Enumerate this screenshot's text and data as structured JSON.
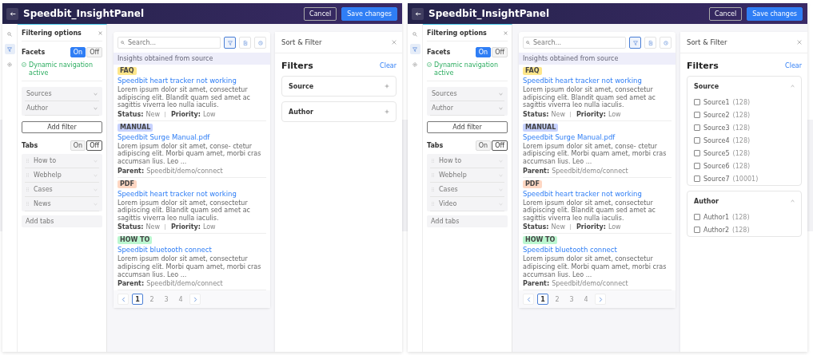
{
  "windows": [
    {
      "title": "Speedbit_InsightPanel",
      "buttons": [
        "Cancel",
        "Save changes"
      ],
      "rail": [
        {
          "kind": "search",
          "selected": false
        },
        {
          "kind": "filter",
          "selected": true
        },
        {
          "kind": "settings",
          "selected": false
        }
      ],
      "options": {
        "title": "Filtering options",
        "facets_label": "Facets",
        "facets_toggle": [
          {
            "label": "On",
            "selected": true
          },
          {
            "label": "Off",
            "selected": false
          }
        ],
        "status": "Dynamic navigation active",
        "facets": [
          "Sources",
          "Author"
        ],
        "add_button": "Add filter",
        "tabs_label": "Tabs",
        "tabs_toggle": [
          {
            "label": "On",
            "selected": false
          },
          {
            "label": "Off",
            "selected": true
          }
        ],
        "tabs": [
          "How to",
          "Webhelp",
          "Cases",
          "News"
        ],
        "add_tabs": {
          "placeholder": "Add tabs"
        }
      },
      "results": {
        "search": {
          "placeholder": "Search..."
        },
        "tools": [
          {
            "kind": "filter",
            "selected": true
          },
          {
            "kind": "doc",
            "selected": false
          },
          {
            "kind": "clock",
            "selected": false
          }
        ],
        "info": "Insights obtained from source",
        "items": [
          {
            "tag": "FAQ",
            "color": "#fde68a",
            "title": "Speedbit heart tracker not working",
            "snippet": "Lorem ipsum dolor sit amet, consectetur adipiscing elit. Blandit quam sed amet ac sagittis viverra leo nulla iaculis.",
            "meta": [
              {
                "label": "Status:",
                "value": "New"
              },
              {
                "label": "Priority:",
                "value": "Low"
              }
            ]
          },
          {
            "tag": "MANUAL",
            "color": "#c7d2fe",
            "title": "Speedbit Surge Manual.pdf",
            "snippet": "Lorem ipsum dolor sit amet, conse- ctetur adipiscing elit. Morbi quam amet, morbi cras accumsan lius. Leo ...",
            "meta": [
              {
                "label": "Parent:",
                "value": "Speedbit/demo/connect"
              }
            ]
          },
          {
            "tag": "PDF",
            "color": "#fed7c3",
            "title": "Speedbit heart tracker not working",
            "snippet": "Lorem ipsum dolor sit amet, consectetur adipiscing elit. Blandit quam sed amet ac sagittis viverra leo nulla iaculis.",
            "meta": [
              {
                "label": "Status:",
                "value": "New"
              },
              {
                "label": "Priority:",
                "value": "Low"
              }
            ]
          },
          {
            "tag": "HOW TO",
            "color": "#bbf7d0",
            "title": "Speedbit bluetooth connect",
            "snippet": "Lorem ipsum dolor sit amet, consectetur adipiscing elit. Morbi quam amet, morbi cras accumsan lius. Leo ...",
            "meta": [
              {
                "label": "Parent:",
                "value": "Speedbit/demo/connect"
              }
            ]
          }
        ],
        "pages": [
          {
            "label": "1",
            "selected": true
          },
          {
            "label": "2",
            "selected": false
          },
          {
            "label": "3",
            "selected": false
          },
          {
            "label": "4",
            "selected": false
          }
        ]
      },
      "sort": {
        "title": "Sort & Filter",
        "heading": "Filters",
        "clear": "Clear",
        "sections": [
          {
            "name": "Source",
            "expanded": false
          },
          {
            "name": "Author",
            "expanded": false
          }
        ]
      }
    },
    {
      "title": "Speedbit_InsightPanel",
      "buttons": [
        "Cancel",
        "Save changes"
      ],
      "rail": [
        {
          "kind": "search",
          "selected": false
        },
        {
          "kind": "filter",
          "selected": true
        },
        {
          "kind": "settings",
          "selected": false
        }
      ],
      "options": {
        "title": "Filtering options",
        "facets_label": "Facets",
        "facets_toggle": [
          {
            "label": "On",
            "selected": true
          },
          {
            "label": "Off",
            "selected": false
          }
        ],
        "status": "Dynamic navigation active",
        "facets": [
          "Sources",
          "Author"
        ],
        "add_button": "Add filter",
        "tabs_label": "Tabs",
        "tabs_toggle": [
          {
            "label": "On",
            "selected": false
          },
          {
            "label": "Off",
            "selected": true
          }
        ],
        "tabs": [
          "How to",
          "Webhelp",
          "Cases",
          "Video"
        ],
        "add_tabs": {
          "placeholder": "Add tabs"
        }
      },
      "results": {
        "search": {
          "placeholder": "Search..."
        },
        "tools": [
          {
            "kind": "filter",
            "selected": true
          },
          {
            "kind": "doc",
            "selected": false
          },
          {
            "kind": "clock",
            "selected": false
          }
        ],
        "info": "Insights obtained from source",
        "items": [
          {
            "tag": "FAQ",
            "color": "#fde68a",
            "title": "Speedbit heart tracker not working",
            "snippet": "Lorem ipsum dolor sit amet, consectetur adipiscing elit. Blandit quam sed amet ac sagittis viverra leo nulla iaculis.",
            "meta": [
              {
                "label": "Status:",
                "value": "New"
              },
              {
                "label": "Priority:",
                "value": "Low"
              }
            ]
          },
          {
            "tag": "MANUAL",
            "color": "#c7d2fe",
            "title": "Speedbit Surge Manual.pdf",
            "snippet": "Lorem ipsum dolor sit amet, conse- ctetur adipiscing elit. Morbi quam amet, morbi cras accumsan lius. Leo ...",
            "meta": [
              {
                "label": "Parent:",
                "value": "Speedbit/demo/connect"
              }
            ]
          },
          {
            "tag": "PDF",
            "color": "#fed7c3",
            "title": "Speedbit heart tracker not working",
            "snippet": "Lorem ipsum dolor sit amet, consectetur adipiscing elit. Blandit quam sed amet ac sagittis viverra leo nulla iaculis.",
            "meta": [
              {
                "label": "Status:",
                "value": "New"
              },
              {
                "label": "Priority:",
                "value": "Low"
              }
            ]
          },
          {
            "tag": "HOW TO",
            "color": "#bbf7d0",
            "title": "Speedbit bluetooth connect",
            "snippet": "Lorem ipsum dolor sit amet, consectetur adipiscing elit. Morbi quam amet, morbi cras accumsan lius. Leo ...",
            "meta": [
              {
                "label": "Parent:",
                "value": "Speedbit/demo/connect"
              }
            ]
          }
        ],
        "pages": [
          {
            "label": "1",
            "selected": true
          },
          {
            "label": "2",
            "selected": false
          },
          {
            "label": "3",
            "selected": false
          },
          {
            "label": "4",
            "selected": false
          }
        ]
      },
      "sort": {
        "title": "Sort & Filter",
        "heading": "Filters",
        "clear": "Clear",
        "sections": [
          {
            "name": "Source",
            "expanded": true,
            "options": [
              {
                "label": "Source1",
                "count": "(128)",
                "checked": false
              },
              {
                "label": "Source2",
                "count": "(128)",
                "checked": false
              },
              {
                "label": "Source3",
                "count": "(128)",
                "checked": false
              },
              {
                "label": "Source4",
                "count": "(128)",
                "checked": false
              },
              {
                "label": "Source5",
                "count": "(128)",
                "checked": false
              },
              {
                "label": "Source6",
                "count": "(128)",
                "checked": false
              },
              {
                "label": "Source7",
                "count": "(10001)",
                "checked": false
              }
            ]
          },
          {
            "name": "Author",
            "expanded": true,
            "options": [
              {
                "label": "Author1",
                "count": "(128)",
                "checked": false
              },
              {
                "label": "Author2",
                "count": "(128)",
                "checked": false
              }
            ]
          }
        ]
      }
    }
  ]
}
